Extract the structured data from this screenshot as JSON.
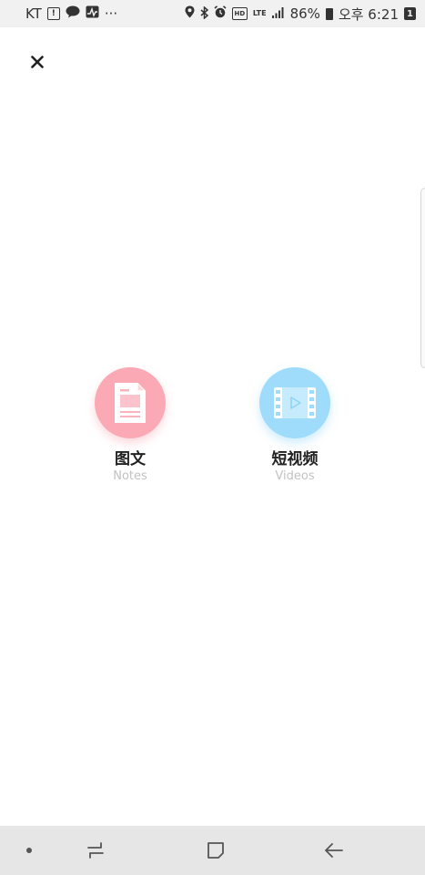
{
  "status_bar": {
    "carrier": "KT",
    "more": "···",
    "network": "LTE",
    "battery": "86%",
    "time": "오후 6:21",
    "notification_count": "1"
  },
  "options": [
    {
      "label": "图文",
      "sublabel": "Notes",
      "icon": "document-icon",
      "color": "#fba9b4"
    },
    {
      "label": "短视频",
      "sublabel": "Videos",
      "icon": "video-film-icon",
      "color": "#9fdcfb"
    }
  ],
  "icons": {
    "close": "close-icon",
    "nav": [
      "nav-dot-icon",
      "recent-apps-icon",
      "home-icon",
      "back-icon"
    ]
  }
}
